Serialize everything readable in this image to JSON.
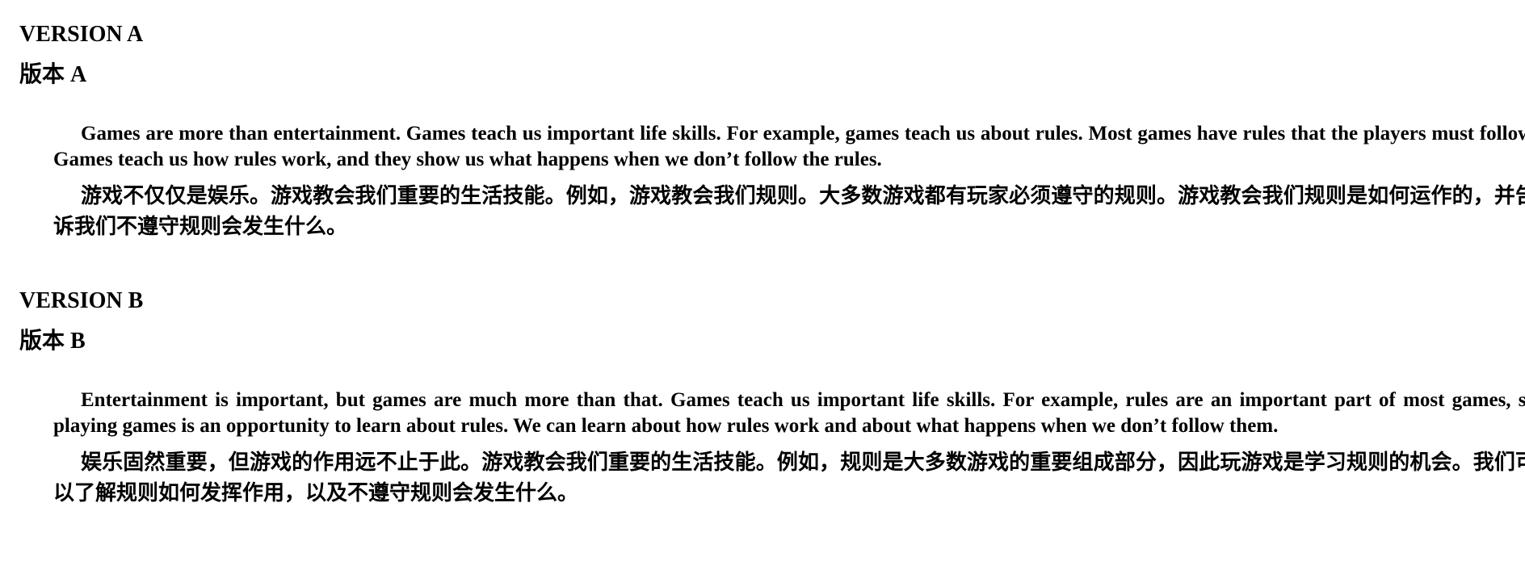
{
  "version_a": {
    "heading_en": "VERSION A",
    "heading_zh": "版本 A",
    "paragraph_en": "Games are more than entertainment. Games teach us important life skills. For example, games teach us about rules. Most games have rules that the players must follow. Games teach us how rules work, and they show us what happens when we don’t follow the rules.",
    "paragraph_zh": "游戏不仅仅是娱乐。游戏教会我们重要的生活技能。例如，游戏教会我们规则。大多数游戏都有玩家必须遵守的规则。游戏教会我们规则是如何运作的，并告诉我们不遵守规则会发生什么。"
  },
  "version_b": {
    "heading_en": "VERSION B",
    "heading_zh": "版本 B",
    "paragraph_en": "Entertainment is important, but games are much more than that. Games teach us important life skills. For example, rules are an important part of most games, so playing games is an opportunity to learn about rules. We can learn about how rules work and about what happens when we don’t follow them.",
    "paragraph_zh": "娱乐固然重要，但游戏的作用远不止于此。游戏教会我们重要的生活技能。例如，规则是大多数游戏的重要组成部分，因此玩游戏是学习规则的机会。我们可以了解规则如何发挥作用，以及不遵守规则会发生什么。"
  }
}
